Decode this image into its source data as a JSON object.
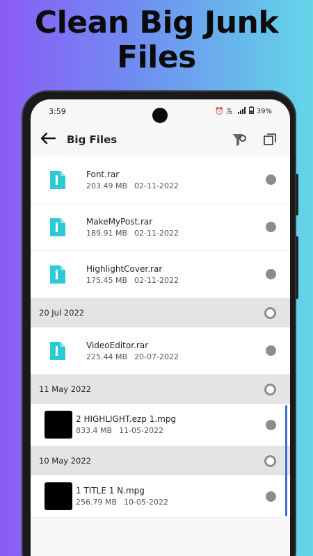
{
  "headline": "Clean Big Junk Files",
  "status": {
    "time": "3:59",
    "battery": "39%"
  },
  "appbar": {
    "title": "Big Files"
  },
  "items": [
    {
      "kind": "file",
      "icon": "zip-icon",
      "name": "Font.rar",
      "size": "203.49 MB",
      "date": "02-11-2022"
    },
    {
      "kind": "file",
      "icon": "zip-icon",
      "name": "MakeMyPost.rar",
      "size": "189.91 MB",
      "date": "02-11-2022"
    },
    {
      "kind": "file",
      "icon": "zip-icon",
      "name": "HighlightCover.rar",
      "size": "175.45 MB",
      "date": "02-11-2022"
    },
    {
      "kind": "section",
      "label": "20 Jul 2022"
    },
    {
      "kind": "file",
      "icon": "zip-icon",
      "name": "VideoEditor.rar",
      "size": "225.44 MB",
      "date": "20-07-2022"
    },
    {
      "kind": "section",
      "label": "11 May 2022"
    },
    {
      "kind": "file",
      "icon": "video-thumbnail",
      "name": "2 HIGHLIGHT.ezp 1.mpg",
      "size": "833.4 MB",
      "date": "11-05-2022"
    },
    {
      "kind": "section",
      "label": "10 May 2022"
    },
    {
      "kind": "file",
      "icon": "video-thumbnail",
      "name": "1 TITLE 1 N.mpg",
      "size": "256.79 MB",
      "date": "10-05-2022"
    }
  ]
}
